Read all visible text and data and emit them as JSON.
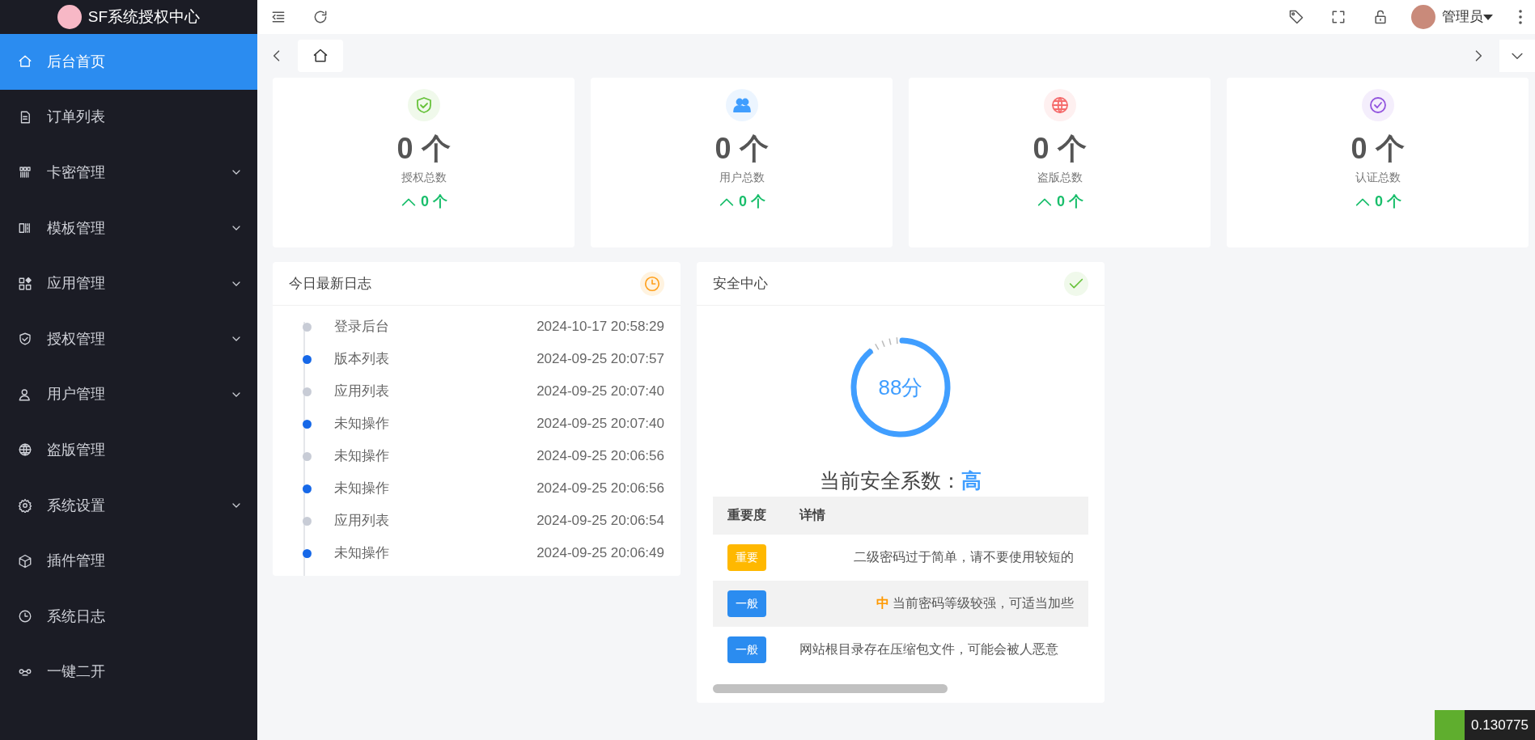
{
  "brand": {
    "title": "SF系统授权中心"
  },
  "sidebar": {
    "items": [
      {
        "label": "后台首页",
        "selected": true,
        "expandable": false
      },
      {
        "label": "订单列表",
        "selected": false,
        "expandable": false
      },
      {
        "label": "卡密管理",
        "selected": false,
        "expandable": true
      },
      {
        "label": "模板管理",
        "selected": false,
        "expandable": true
      },
      {
        "label": "应用管理",
        "selected": false,
        "expandable": true
      },
      {
        "label": "授权管理",
        "selected": false,
        "expandable": true
      },
      {
        "label": "用户管理",
        "selected": false,
        "expandable": true
      },
      {
        "label": "盗版管理",
        "selected": false,
        "expandable": false
      },
      {
        "label": "系统设置",
        "selected": false,
        "expandable": true
      },
      {
        "label": "插件管理",
        "selected": false,
        "expandable": false
      },
      {
        "label": "系统日志",
        "selected": false,
        "expandable": false
      },
      {
        "label": "一键二开",
        "selected": false,
        "expandable": false
      }
    ]
  },
  "topbar": {
    "user": "管理员"
  },
  "tabs": [
    {
      "selected": true
    }
  ],
  "stats": [
    {
      "value": "0 个",
      "label": "授权总数",
      "delta": "0 个",
      "color": "#67c23a"
    },
    {
      "value": "0 个",
      "label": "用户总数",
      "delta": "0 个",
      "color": "#409eff"
    },
    {
      "value": "0 个",
      "label": "盗版总数",
      "delta": "0 个",
      "color": "#f56c6c"
    },
    {
      "value": "0 个",
      "label": "认证总数",
      "delta": "0 个",
      "color": "#9254de"
    }
  ],
  "log_panel": {
    "title": "今日最新日志",
    "entries": [
      {
        "action": "登录后台",
        "time": "2024-10-17 20:58:29",
        "color": "#c8ccd6"
      },
      {
        "action": "版本列表",
        "time": "2024-09-25 20:07:57",
        "color": "#1668e8"
      },
      {
        "action": "应用列表",
        "time": "2024-09-25 20:07:40",
        "color": "#c8ccd6"
      },
      {
        "action": "未知操作",
        "time": "2024-09-25 20:07:40",
        "color": "#1668e8"
      },
      {
        "action": "未知操作",
        "time": "2024-09-25 20:06:56",
        "color": "#c8ccd6"
      },
      {
        "action": "未知操作",
        "time": "2024-09-25 20:06:56",
        "color": "#1668e8"
      },
      {
        "action": "应用列表",
        "time": "2024-09-25 20:06:54",
        "color": "#c8ccd6"
      },
      {
        "action": "未知操作",
        "time": "2024-09-25 20:06:49",
        "color": "#1668e8"
      }
    ]
  },
  "security_panel": {
    "title": "安全中心",
    "score": "88分",
    "level": 0.88,
    "rating_label": "当前安全系数：",
    "rating": "高",
    "table": {
      "columns": [
        "重要度",
        "详情"
      ],
      "rows": [
        {
          "importance": "重要",
          "kind": "major",
          "detail": "二级密码过于简单，请不要使用较短的"
        },
        {
          "importance": "一般",
          "kind": "minor",
          "tag": "中",
          "detail": "当前密码等级较强，可适当加些"
        },
        {
          "importance": "一般",
          "kind": "minor",
          "detail": "网站根目录存在压缩包文件，可能会被人恶意"
        }
      ]
    }
  },
  "trace_badge": {
    "time": "0.130775"
  }
}
